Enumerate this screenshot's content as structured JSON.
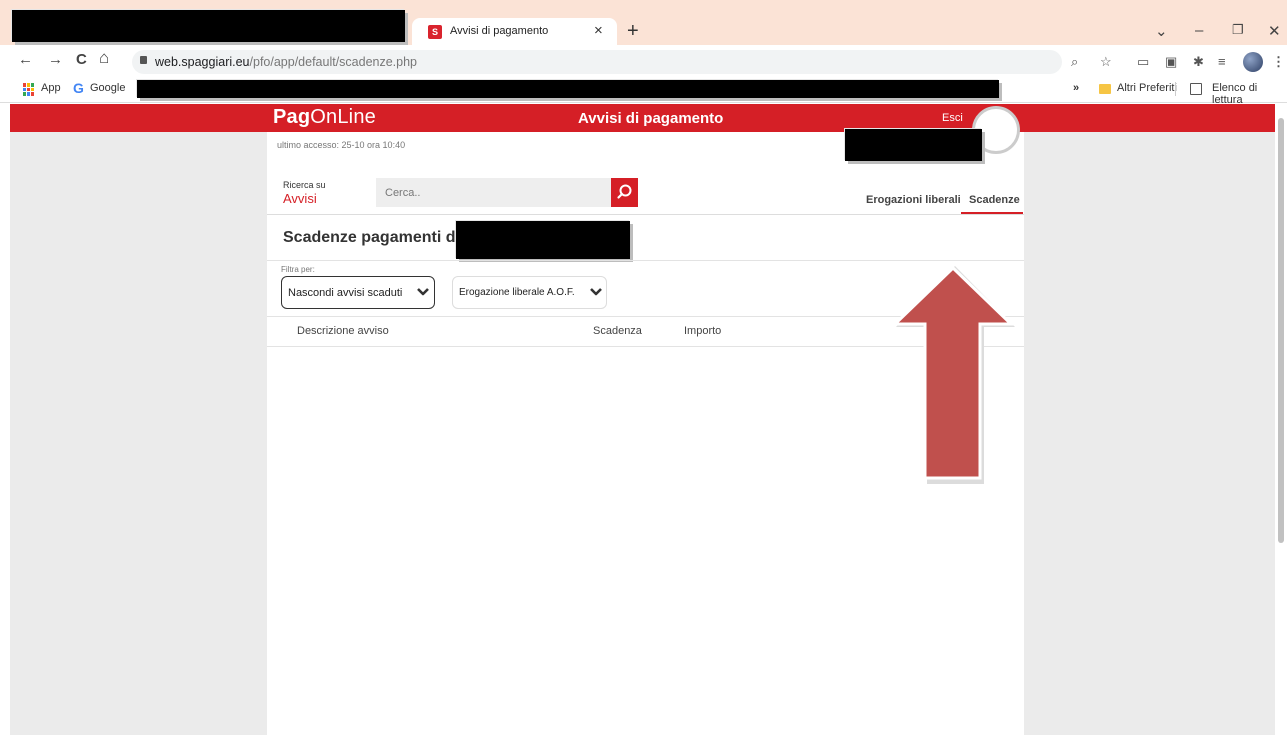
{
  "browser": {
    "tab_title": "Avvisi di pagamento",
    "tab_close": "×",
    "new_tab": "+",
    "url_host": "web.spaggiari.eu",
    "url_path": "/pfo/app/default/scadenze.php",
    "nav": {
      "back": "←",
      "forward": "→",
      "reload": "C",
      "home": "⌂"
    },
    "window_controls": {
      "list": "⌄",
      "minimize": "–",
      "restore": "❐",
      "close": "✕"
    },
    "bookmarks": {
      "apps": "App",
      "google": "Google",
      "more": "»",
      "other_favorites": "Altri Preferiti",
      "reading_list": "Elenco di lettura"
    }
  },
  "header": {
    "logo_bold": "Pag",
    "logo_rest": "OnLine",
    "title": "Avvisi di pagamento",
    "logout": "Esci"
  },
  "last_access": "ultimo accesso: 25-10 ora 10:40",
  "search": {
    "label_small": "Ricerca su",
    "label_big": "Avvisi",
    "placeholder": "Cerca.."
  },
  "tabs": [
    {
      "label": "Erogazioni liberali",
      "active": false
    },
    {
      "label": "Scadenze",
      "active": true
    }
  ],
  "section": {
    "title": "Scadenze pagamenti di"
  },
  "filters": {
    "label": "Filtra per:",
    "hide_expired": "Nascondi avvisi scaduti",
    "category": "Erogazione liberale A.O.F."
  },
  "table": {
    "columns": [
      "Descrizione avviso",
      "Scadenza",
      "Importo"
    ],
    "rows": []
  },
  "colors": {
    "brand_red": "#d51f26",
    "arrow_red": "#c0504d",
    "titlebar": "#fbe3d6"
  }
}
